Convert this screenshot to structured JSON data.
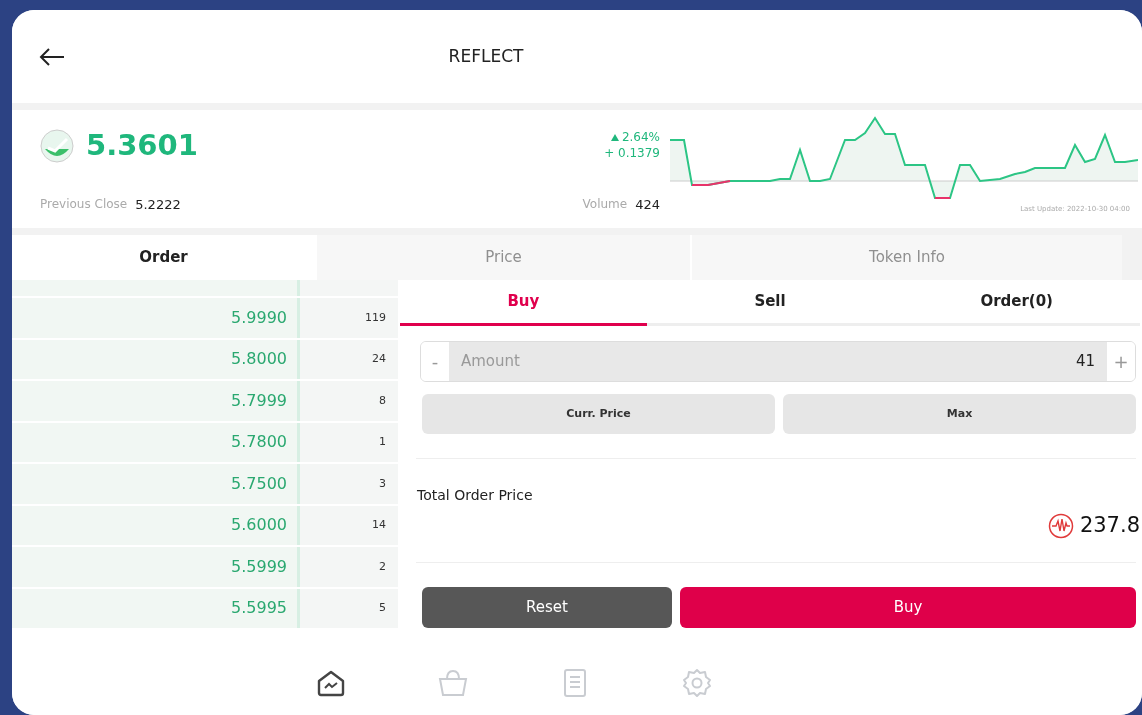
{
  "header": {
    "title": "REFLECT"
  },
  "price": {
    "value": "5.3601",
    "change_percent": "2.64%",
    "change_abs": "+ 0.1379",
    "previous_close_label": "Previous Close",
    "previous_close": "5.2222",
    "volume_label": "Volume",
    "volume": "424",
    "last_update": "Last Update: 2022-10-30 04:00"
  },
  "tabs": [
    {
      "label": "Order",
      "selected": true
    },
    {
      "label": "Price",
      "selected": false
    },
    {
      "label": "Token Info",
      "selected": false
    }
  ],
  "order_book": [
    {
      "price": "5.9990",
      "qty": "119"
    },
    {
      "price": "5.8000",
      "qty": "24"
    },
    {
      "price": "5.7999",
      "qty": "8"
    },
    {
      "price": "5.7800",
      "qty": "1"
    },
    {
      "price": "5.7500",
      "qty": "3"
    },
    {
      "price": "5.6000",
      "qty": "14"
    },
    {
      "price": "5.5999",
      "qty": "2"
    },
    {
      "price": "5.5995",
      "qty": "5"
    }
  ],
  "trade_tabs": [
    {
      "label": "Buy",
      "selected": true
    },
    {
      "label": "Sell",
      "selected": false
    },
    {
      "label": "Order(0)",
      "selected": false
    }
  ],
  "amount": {
    "minus": "-",
    "placeholder": "Amount",
    "value": "41",
    "plus": "+"
  },
  "quick_buttons": [
    "Curr. Price",
    "Max"
  ],
  "total": {
    "label": "Total Order Price",
    "value": "237.8"
  },
  "actions": [
    {
      "label": "Reset",
      "kind": "secondary"
    },
    {
      "label": "Buy",
      "kind": "primary"
    }
  ],
  "bottom_nav": [
    {
      "kind": "chart",
      "selected": true
    },
    {
      "kind": "basket",
      "selected": false
    },
    {
      "kind": "receipt",
      "selected": false
    },
    {
      "kind": "settings",
      "selected": false
    }
  ]
}
